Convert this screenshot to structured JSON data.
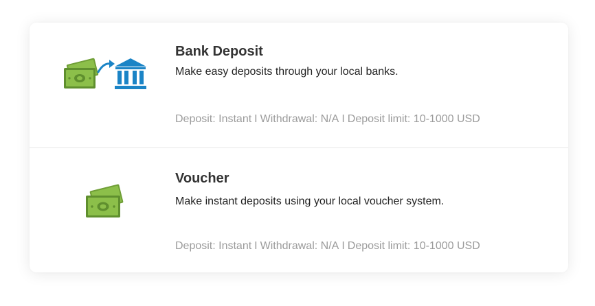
{
  "methods": [
    {
      "title": "Bank Deposit",
      "description": "Make easy deposits through your local banks.",
      "meta": {
        "deposit": "Deposit: Instant",
        "withdrawal": "Withdrawal: N/A",
        "limit": "Deposit limit: 10-1000 USD",
        "separator": "I"
      },
      "icons": [
        "cash-icon",
        "arrow-icon",
        "bank-icon"
      ]
    },
    {
      "title": "Voucher",
      "description": "Make instant deposits using your local voucher system.",
      "meta": {
        "deposit": "Deposit: Instant",
        "withdrawal": "Withdrawal: N/A",
        "limit": "Deposit limit: 10-1000 USD",
        "separator": "I"
      },
      "icons": [
        "cash-icon"
      ]
    }
  ],
  "colors": {
    "cash_light": "#8cbf4a",
    "cash_dark": "#5f8f2e",
    "bank_blue": "#1b84c6",
    "meta_text": "#9b9b9b"
  }
}
